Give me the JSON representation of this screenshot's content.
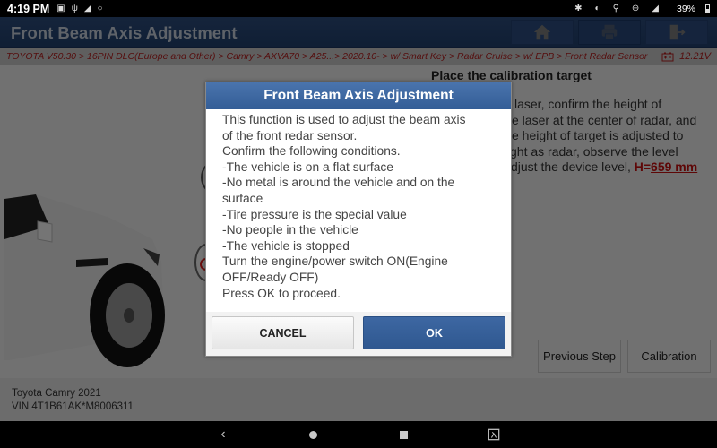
{
  "status_bar": {
    "time": "4:19 PM",
    "left_icons": [
      "image-icon",
      "usb-icon",
      "wifi-icon",
      "bluetooth-circle-icon"
    ],
    "right_icons": [
      "bluetooth-icon",
      "vibrate-icon",
      "location-icon",
      "do-not-disturb-icon",
      "wifi-icon"
    ],
    "battery_percent": "39%"
  },
  "header": {
    "title": "Front Beam Axis Adjustment",
    "buttons": [
      {
        "name": "home",
        "icon": "home-icon"
      },
      {
        "name": "print",
        "icon": "printer-icon"
      },
      {
        "name": "exit",
        "icon": "exit-icon"
      }
    ]
  },
  "breadcrumb": {
    "path": "TOYOTA V50.30 > 16PIN DLC(Europe and Other) > Camry > AXVA70 > A25...> 2020.10- > w/ Smart Key > Radar Cruise > w/ EPB > Front Radar Sensor",
    "voltage": "12.21V"
  },
  "content": {
    "section_title": "Place the calibration target",
    "instructions_lines": [
      "laser, confirm the height of",
      "e laser at the center of radar, and",
      "e height of target is adjusted to",
      "ght as radar, observe the level",
      "djust the device level, "
    ],
    "height_label": "H=",
    "height_value": "659 mm",
    "buttons": {
      "previous_step": "Previous Step",
      "calibration": "Calibration"
    }
  },
  "vehicle": {
    "model": "Toyota Camry 2021",
    "vin": "VIN 4T1B61AK*M8006311"
  },
  "dialog": {
    "title": "Front Beam Axis Adjustment",
    "lines": [
      "This function is used to adjust the beam axis",
      "of the front redar sensor.",
      "Confirm the following conditions.",
      "-The vehicle is on a flat surface",
      "-No metal is around the vehicle and on the",
      "surface",
      "-Tire pressure is the special value",
      "-No people in the vehicle",
      "-The vehicle is stopped",
      "Turn the engine/power switch ON(Engine",
      "OFF/Ready OFF)",
      "Press OK to proceed."
    ],
    "cancel_label": "CANCEL",
    "ok_label": "OK"
  },
  "nav_bar": {
    "items": [
      "back-icon",
      "home-icon",
      "recents-icon",
      "screenshot-icon"
    ]
  },
  "colors": {
    "header_blue": "#2d4c7c",
    "dialog_header_blue": "#4a74ad",
    "ok_button_blue": "#3d67a2",
    "breadcrumb_red": "#b22020",
    "highlight_red": "#c41010"
  }
}
